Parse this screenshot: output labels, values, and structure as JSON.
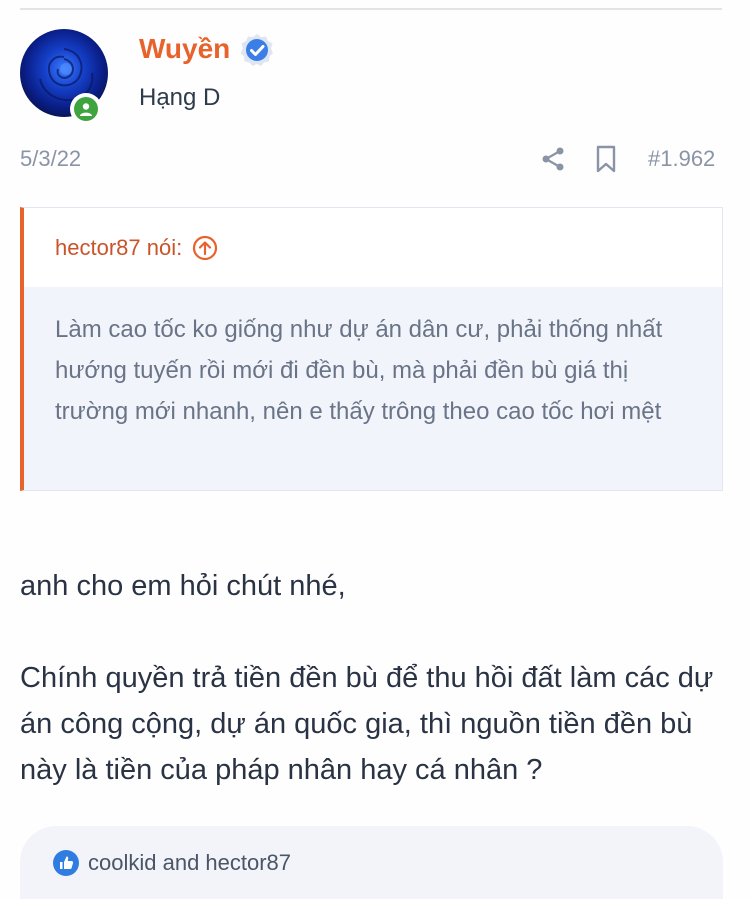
{
  "post": {
    "author": {
      "name": "Wuyền",
      "rank": "Hạng D",
      "verified_icon": "verified-badge-icon",
      "online_icon": "online-status-icon"
    },
    "date": "5/3/22",
    "post_number": "#1.962",
    "actions": [
      "share-icon",
      "bookmark-icon"
    ],
    "quote": {
      "header": "hector87 nói:",
      "text": "Làm cao tốc ko giống như dự án dân cư, phải thống nhất hướng tuyến rồi mới đi đền bù, mà phải đền bù giá thị trường mới nhanh, nên e thấy trông theo cao tốc hơi mệt"
    },
    "body": [
      "anh cho em hỏi chút nhé,",
      "Chính quyền trả tiền đền bù để thu hồi đất làm các dự án công cộng, dự án quốc gia, thì nguồn tiền đền bù này là tiền của pháp nhân hay cá nhân ?"
    ],
    "reactions": "coolkid and hector87"
  },
  "colors": {
    "accent": "#e8622c",
    "verified": "#3b7fe6",
    "online": "#3fa33f",
    "like": "#2f7de0"
  }
}
